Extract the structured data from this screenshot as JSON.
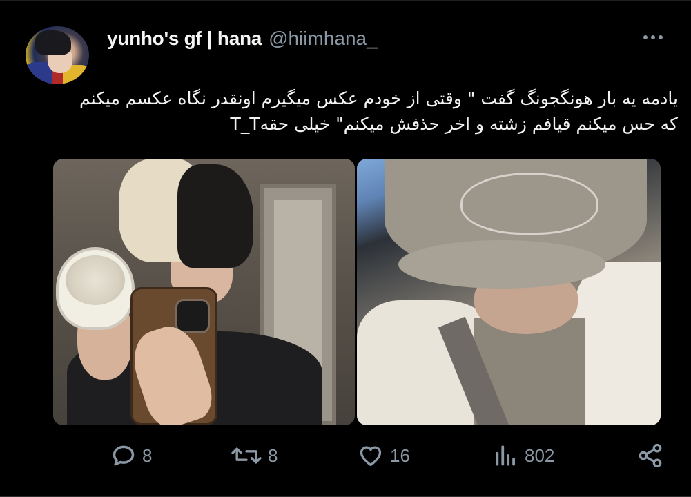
{
  "tweet": {
    "display_name": "yunho's gf | hana",
    "handle": "@hiimhana_",
    "text": "یادمه یه بار هونگجونگ گفت \" وقتی از خودم عکس میگیرم اونقدر نگاه عکسم میکنم که حس میکنم قیافم زشته و اخر حذفش میکنم\" خیلی حقهT_T",
    "media": [
      "photo-left",
      "photo-right"
    ]
  },
  "actions": {
    "replies": "8",
    "retweets": "8",
    "likes": "16",
    "views": "802"
  },
  "icons": {
    "more": "more-horizontal-icon",
    "reply": "reply-icon",
    "retweet": "retweet-icon",
    "like": "heart-icon",
    "views": "views-chart-icon",
    "share": "share-icon"
  },
  "colors": {
    "background": "#000000",
    "text": "#e7e9ea",
    "secondary": "#8b98a5"
  }
}
